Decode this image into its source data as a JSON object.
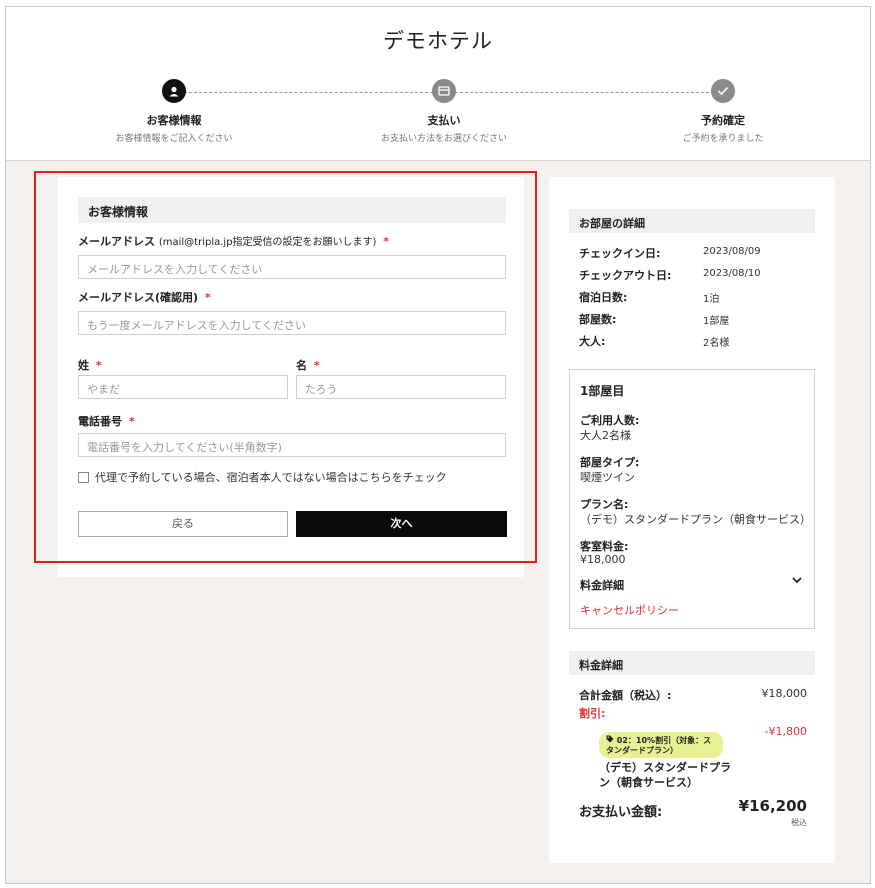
{
  "hotel": {
    "title": "デモホテル"
  },
  "steps": [
    {
      "label": "お客様情報",
      "sub": "お客様情報をご記入ください"
    },
    {
      "label": "支払い",
      "sub": "お支払い方法をお選びください"
    },
    {
      "label": "予約確定",
      "sub": "ご予約を承りました"
    }
  ],
  "form": {
    "section_title": "お客様情報",
    "email_label": "メールアドレス",
    "email_note": "(mail@tripla.jp指定受信の設定をお願いします)",
    "email_placeholder": "メールアドレスを入力してください",
    "email_confirm_label": "メールアドレス(確認用)",
    "email_confirm_placeholder": "もう一度メールアドレスを入力してください",
    "last_name_label": "姓",
    "last_name_placeholder": "やまだ",
    "first_name_label": "名",
    "first_name_placeholder": "たろう",
    "phone_label": "電話番号",
    "phone_placeholder": "電話番号を入力してください(半角数字)",
    "proxy_checkbox_label": "代理で予約している場合、宿泊者本人ではない場合はこちらをチェック",
    "required_mark": "*",
    "back_button": "戻る",
    "next_button": "次へ"
  },
  "room_details": {
    "title": "お部屋の詳細",
    "rows": [
      {
        "label": "チェックイン日:",
        "value": "2023/08/09"
      },
      {
        "label": "チェックアウト日:",
        "value": "2023/08/10"
      },
      {
        "label": "宿泊日数:",
        "value": "1泊"
      },
      {
        "label": "部屋数:",
        "value": "1部屋"
      },
      {
        "label": "大人:",
        "value": "2名様"
      }
    ]
  },
  "room_box": {
    "title": "1部屋目",
    "guests_label": "ご利用人数:",
    "guests_value": "大人2名様",
    "type_label": "部屋タイプ:",
    "type_value": "喫煙ツイン",
    "plan_label": "プラン名:",
    "plan_value": "（デモ）スタンダードプラン（朝食サービス）",
    "rate_label": "客室料金:",
    "rate_value": "¥18,000",
    "fee_detail_label": "料金詳細",
    "cancel_policy": "キャンセルポリシー"
  },
  "price": {
    "title": "料金詳細",
    "total_label": "合計金額（税込）:",
    "total_value": "¥18,000",
    "discount_label": "割引:",
    "discount_value": "-¥1,800",
    "coupon_badge": "02：10%割引（対象：スタンダードプラン）",
    "coupon_plan": "（デモ）スタンダードプラン（朝食サービス）",
    "pay_label": "お支払い金額:",
    "pay_value": "¥16,200",
    "tax_note": "税込"
  },
  "colors": {
    "required": "#e03030",
    "highlight": "#e41e1e",
    "badge": "#e7f093",
    "primary_button": "#0a0a0a"
  }
}
